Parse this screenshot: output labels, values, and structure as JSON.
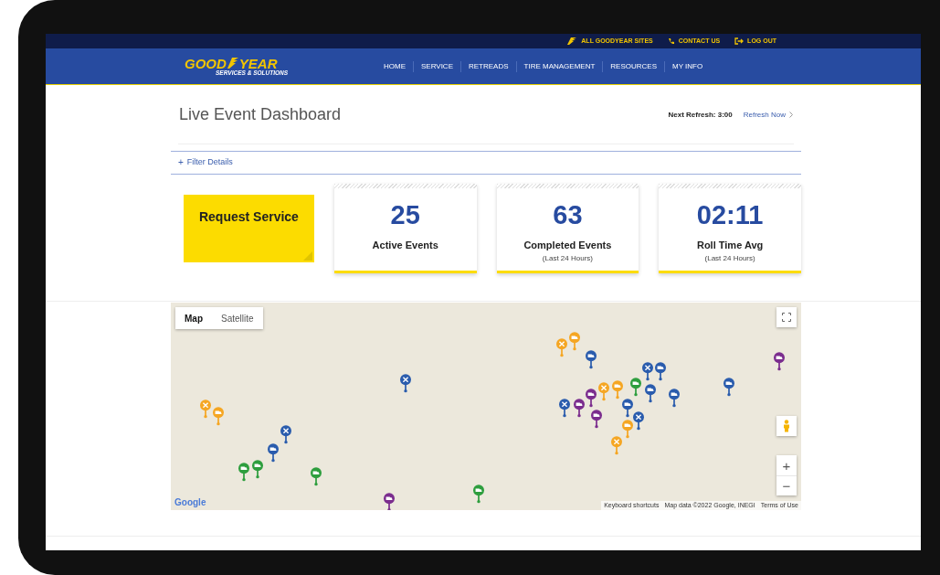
{
  "utility_links": [
    {
      "kind": "wingfoot",
      "label": "ALL GOODYEAR SITES"
    },
    {
      "kind": "phone",
      "label": "CONTACT US"
    },
    {
      "kind": "logout",
      "label": "LOG OUT"
    }
  ],
  "brand": {
    "word_1": "GOOD",
    "word_2": "YEAR",
    "tagline": "SERVICES & SOLUTIONS"
  },
  "nav": [
    "HOME",
    "SERVICE",
    "RETREADS",
    "TIRE MANAGEMENT",
    "RESOURCES",
    "MY INFO"
  ],
  "page_title": "Live Event Dashboard",
  "next_refresh": "Next Refresh: 3:00",
  "refresh_link": "Refresh Now",
  "filter": {
    "icon": "+",
    "label": "Filter Details"
  },
  "request_button": "Request Service",
  "stats": [
    {
      "value": "25",
      "label": "Active Events"
    },
    {
      "value": "63",
      "label": "Completed Events",
      "note": "(Last 24 Hours)"
    },
    {
      "value": "02:11",
      "label": "Roll Time Avg",
      "note": "(Last 24 Hours)"
    }
  ],
  "map": {
    "tabs": [
      {
        "label": "Map",
        "selected": true
      },
      {
        "label": "Satellite",
        "selected": false
      }
    ],
    "zoom_in": "+",
    "zoom_out": "−",
    "logo": "Google",
    "attribution": [
      "Keyboard shortcuts",
      "Map data ©2022 Google, INEGI",
      "Terms of Use"
    ],
    "markers": [
      {
        "kind": "tool",
        "color": "#f5a623"
      },
      {
        "kind": "truck",
        "color": "#f5a623"
      },
      {
        "kind": "tool",
        "color": "#2a5cad"
      },
      {
        "kind": "tool",
        "color": "#2a5cad"
      },
      {
        "kind": "truck",
        "color": "#2a5cad"
      },
      {
        "kind": "truck",
        "color": "#2e9e3e"
      },
      {
        "kind": "truck",
        "color": "#2e9e3e"
      },
      {
        "kind": "truck",
        "color": "#2e9e3e"
      },
      {
        "kind": "truck",
        "color": "#7b2d8e"
      },
      {
        "kind": "truck",
        "color": "#2e9e3e"
      },
      {
        "kind": "tool",
        "color": "#f5a623"
      },
      {
        "kind": "truck",
        "color": "#f5a623"
      },
      {
        "kind": "truck",
        "color": "#2a5cad"
      },
      {
        "kind": "tool",
        "color": "#2a5cad"
      },
      {
        "kind": "truck",
        "color": "#2a5cad"
      },
      {
        "kind": "truck",
        "color": "#2e9e3e"
      },
      {
        "kind": "tool",
        "color": "#f5a623"
      },
      {
        "kind": "truck",
        "color": "#f5a623"
      },
      {
        "kind": "truck",
        "color": "#7b2d8e"
      },
      {
        "kind": "truck",
        "color": "#2a5cad"
      },
      {
        "kind": "truck",
        "color": "#2a5cad"
      },
      {
        "kind": "tool",
        "color": "#2a5cad"
      },
      {
        "kind": "truck",
        "color": "#7b2d8e"
      },
      {
        "kind": "truck",
        "color": "#2a5cad"
      },
      {
        "kind": "tool",
        "color": "#2a5cad"
      },
      {
        "kind": "truck",
        "color": "#7b2d8e"
      },
      {
        "kind": "truck",
        "color": "#f5a623"
      },
      {
        "kind": "tool",
        "color": "#f5a623"
      },
      {
        "kind": "truck",
        "color": "#2a5cad"
      },
      {
        "kind": "truck",
        "color": "#7b2d8e"
      }
    ]
  }
}
